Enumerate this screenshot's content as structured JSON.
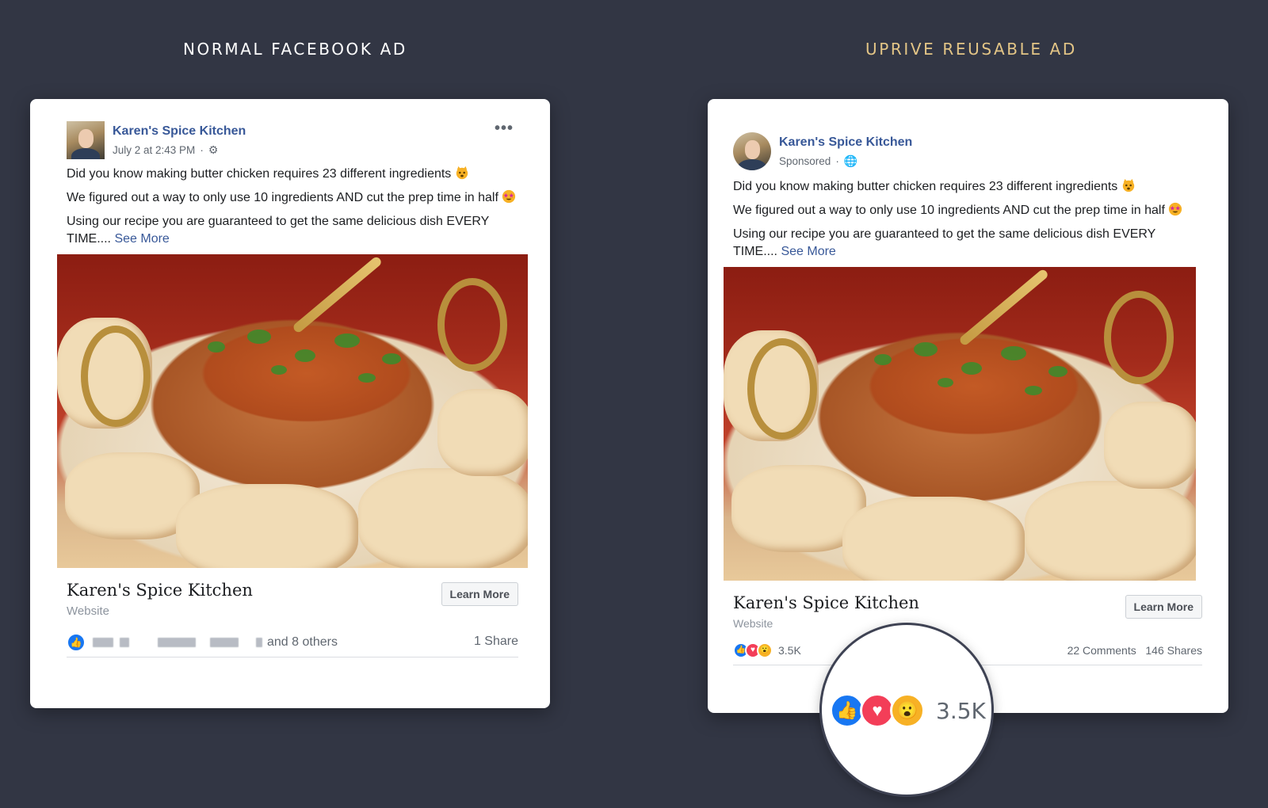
{
  "headings": {
    "left": "NORMAL FACEBOOK AD",
    "right": "UPRIVE REUSABLE AD"
  },
  "colors": {
    "background": "#323644",
    "accent_heading": "#e3c586",
    "facebook_blue": "#385898"
  },
  "normal_ad": {
    "page_name": "Karen's Spice Kitchen",
    "timestamp": "July 2 at 2:43 PM",
    "separator": "·",
    "post_text": {
      "line1": "Did you know making butter chicken requires 23 different ingredients",
      "line2": "We figured out a way to only use 10 ingredients AND cut the prep time in half",
      "line3": "Using our recipe you are guaranteed to get the same delicious dish EVERY TIME....",
      "see_more": "See More"
    },
    "link_title": "Karen's Spice Kitchen",
    "link_subtitle": "Website",
    "cta_label": "Learn More",
    "reactions_text": "and 8 others",
    "share_count": "1 Share",
    "icons": [
      "more-icon",
      "gear-icon",
      "like-icon"
    ]
  },
  "reusable_ad": {
    "page_name": "Karen's Spice Kitchen",
    "sponsored": "Sponsored",
    "separator": "·",
    "post_text": {
      "line1": "Did you know making butter chicken requires 23 different ingredients",
      "line2": "We figured out a way to only use 10 ingredients AND cut the prep time in half",
      "line3": "Using our recipe you are guaranteed to get the same delicious dish EVERY TIME....",
      "see_more": "See More"
    },
    "link_title": "Karen's Spice Kitchen",
    "link_subtitle": "Website",
    "cta_label": "Learn More",
    "reaction_count": "3.5K",
    "comments": "22 Comments",
    "shares": "146 Shares",
    "icons": [
      "globe-icon",
      "like-icon",
      "love-icon",
      "wow-icon"
    ]
  },
  "zoom": {
    "reaction_count": "3.5K"
  }
}
